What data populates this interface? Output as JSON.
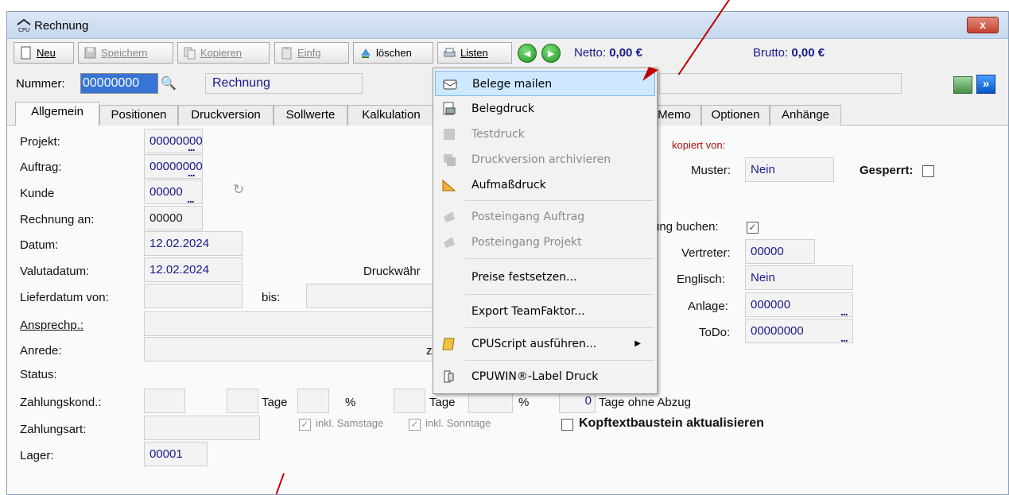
{
  "window": {
    "title": "Rechnung",
    "close_label": "x"
  },
  "toolbar": {
    "new_label": "Neu",
    "save_label": "Speichern",
    "copy_label": "Kopieren",
    "paste_label": "Einfg",
    "delete_label": "löschen",
    "lists_label": "Listen",
    "prev_label": "◄",
    "next_label": "►",
    "netto_label": "Netto:",
    "netto_value": "0,00 €",
    "brutto_label": "Brutto:",
    "brutto_value": "0,00 €"
  },
  "header": {
    "nummer_label": "Nummer:",
    "nummer_value": "00000000",
    "doc_type": "Rechnung",
    "forward_label": "»"
  },
  "tabs": [
    "Allgemein",
    "Positionen",
    "Druckversion",
    "Sollwerte",
    "Kalkulation",
    "Memo",
    "Optionen",
    "Anhänge"
  ],
  "form": {
    "projekt_label": "Projekt:",
    "projekt_value": "00000000",
    "auftrag_label": "Auftrag:",
    "auftrag_value": "00000000",
    "kunde_label": "Kunde",
    "kunde_value": "00000",
    "rechnung_an_label": "Rechnung an:",
    "rechnung_an_value": "00000",
    "datum_label": "Datum:",
    "datum_value": "12.02.2024",
    "valuta_label": "Valutadatum:",
    "valuta_value": "12.02.2024",
    "druckwaehr_label": "Druckwähr",
    "lieferdatum_label": "Lieferdatum von:",
    "bis_label": "bis:",
    "ansprechp_label": "Ansprechp.:",
    "anrede_label": "Anrede:",
    "z_label": "z",
    "status_label": "Status:",
    "zahlungskond_label": "Zahlungskond.:",
    "tage1_label": "Tage",
    "pct1_label": "%",
    "tage2_label": "Tage",
    "pct2_label": "%",
    "tage_ohne_value": "0",
    "tage_ohne_label": "Tage ohne Abzug",
    "zahlungsart_label": "Zahlungsart:",
    "samstage_label": "inkl. Samstage",
    "sonntage_label": "inkl. Sonntage",
    "kopftext_label": "Kopftextbaustein aktualisieren",
    "lager_label": "Lager:",
    "lager_value": "00001",
    "kopiert_label": "kopiert von:",
    "muster_label": "Muster:",
    "muster_value": "Nein",
    "gesperrt_label": "Gesperrt:",
    "buchen_label": "ung buchen:",
    "vertreter_label": "Vertreter:",
    "vertreter_value": "00000",
    "englisch_label": "Englisch:",
    "englisch_value": "Nein",
    "anlage_label": "Anlage:",
    "anlage_value": "000000",
    "todo_label": "ToDo:",
    "todo_value": "00000000",
    "dots": "..."
  },
  "menu": {
    "items": [
      {
        "label": "Belege mailen",
        "enabled": true,
        "highlighted": true,
        "icon": "mail-icon"
      },
      {
        "label": "Belegdruck",
        "enabled": true,
        "icon": "print-icon"
      },
      {
        "label": "Testdruck",
        "enabled": false,
        "icon": "test-print-icon"
      },
      {
        "label": "Druckversion archivieren",
        "enabled": false,
        "icon": "archive-icon"
      },
      {
        "label": "Aufmaßdruck",
        "enabled": true,
        "icon": "ruler-icon"
      },
      {
        "label": "Posteingang Auftrag",
        "enabled": false,
        "icon": "inbox-order-icon"
      },
      {
        "label": "Posteingang Projekt",
        "enabled": false,
        "icon": "inbox-project-icon"
      },
      {
        "label": "Preise festsetzen...",
        "enabled": true
      },
      {
        "label": "Export TeamFaktor...",
        "enabled": true
      },
      {
        "label": "CPUScript ausführen...",
        "enabled": true,
        "icon": "script-icon",
        "submenu": true
      },
      {
        "label": "CPUWIN®-Label Druck",
        "enabled": true,
        "icon": "label-print-icon"
      }
    ],
    "submenu_arrow": "▶"
  },
  "colors": {
    "accent_blue": "#1a1a8c",
    "highlight": "#cde8ff",
    "annotation_red": "#c00000"
  }
}
